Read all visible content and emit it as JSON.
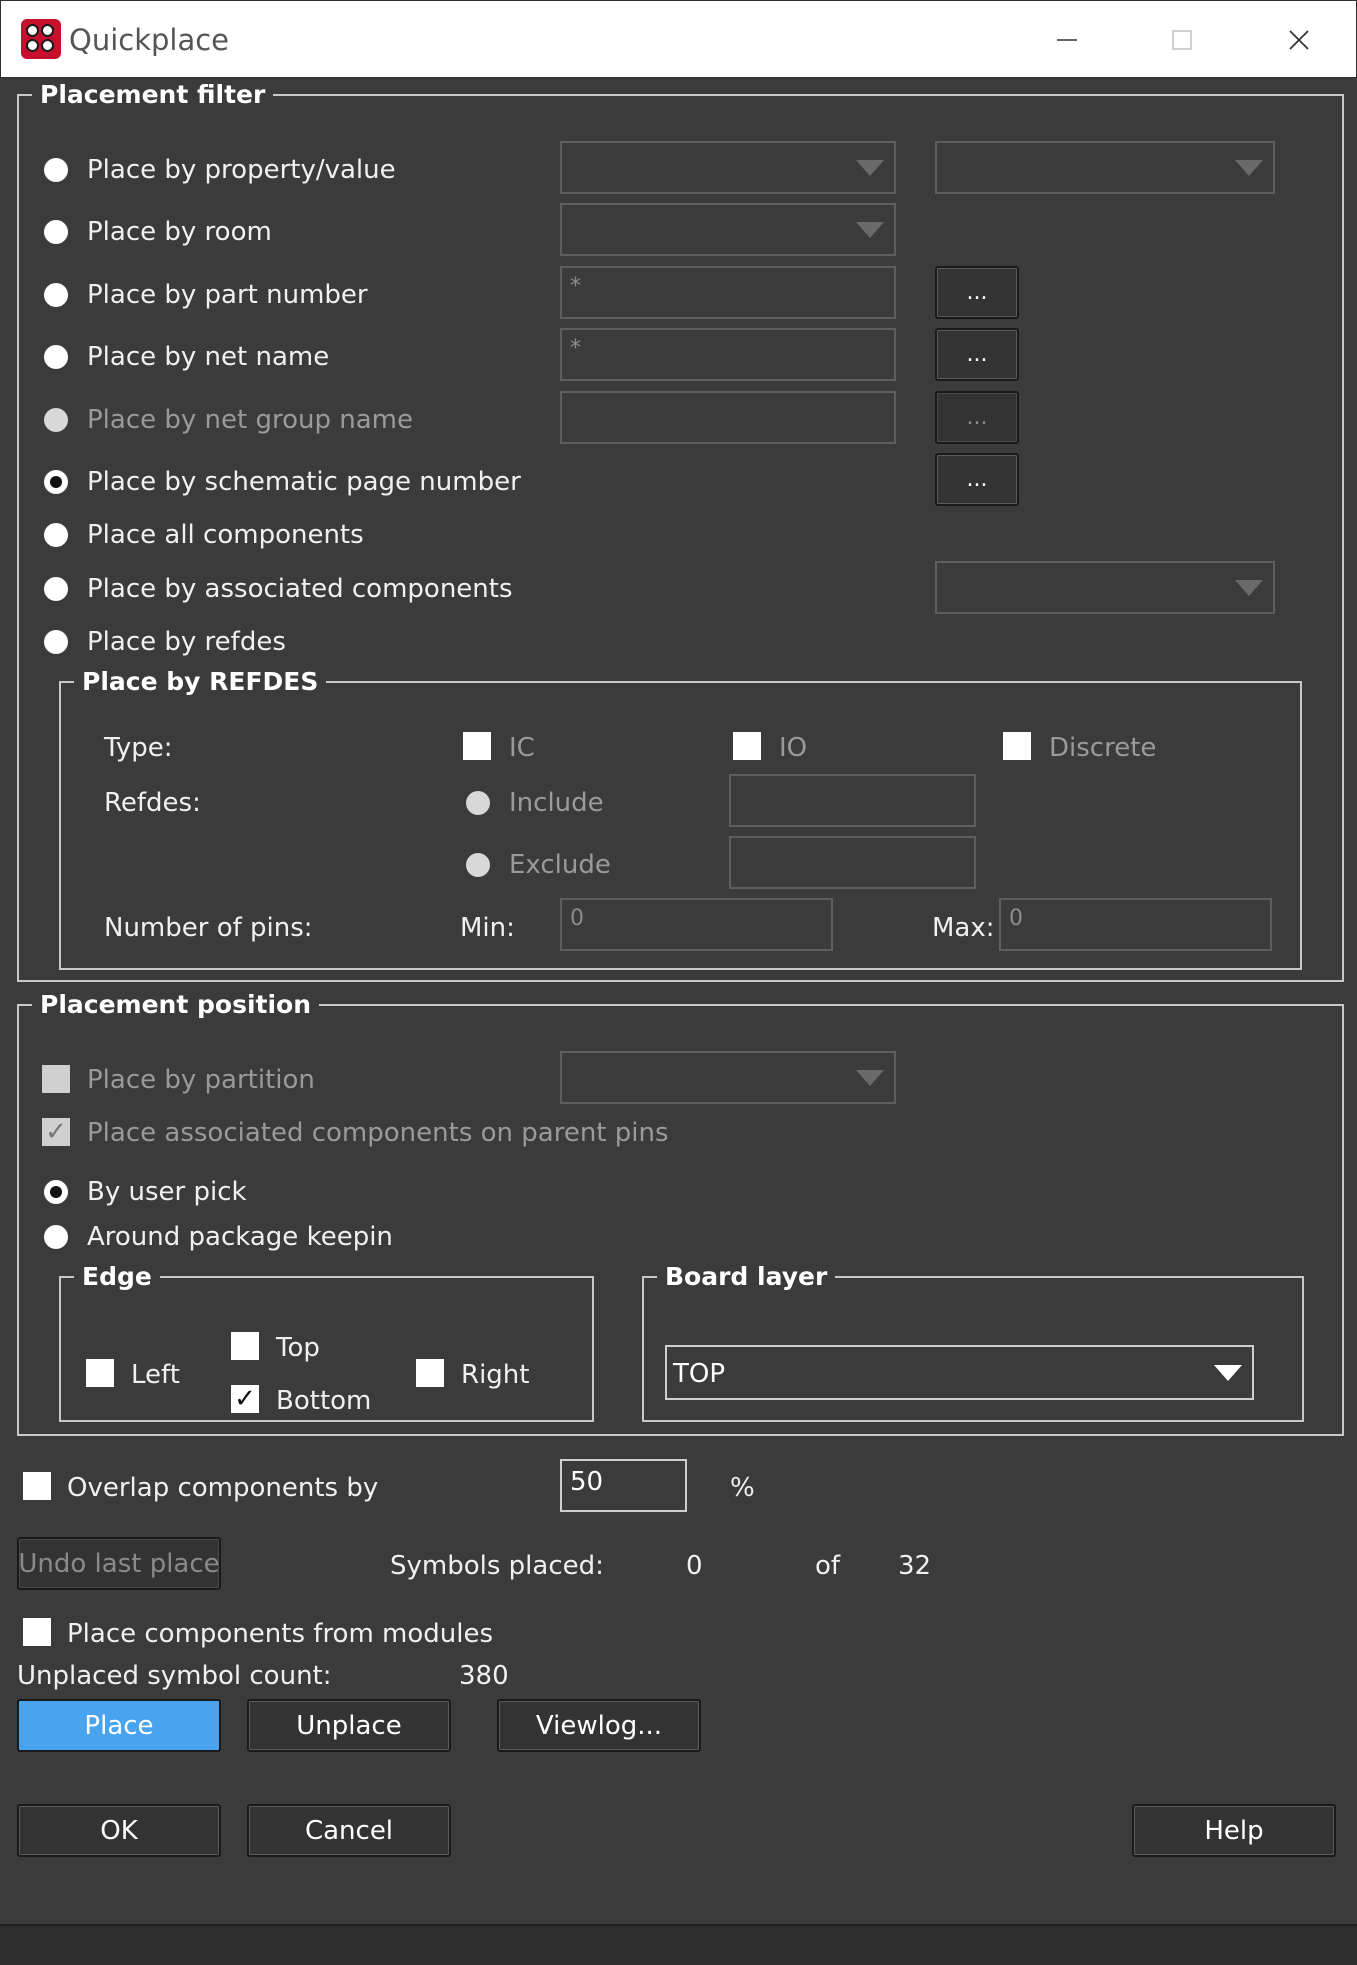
{
  "window": {
    "title": "Quickplace",
    "app_icon": "quickplace-app-icon",
    "controls": [
      "minimize-icon",
      "maximize-icon",
      "close-icon"
    ]
  },
  "placement_filter": {
    "legend": "Placement filter",
    "options": {
      "property_value": "Place by property/value",
      "room": "Place by room",
      "part_number": "Place by part number",
      "net_name": "Place by net name",
      "net_group_name": "Place by net group name",
      "schematic_page_number": "Place by schematic page number",
      "all_components": "Place all components",
      "associated_components": "Place by associated components",
      "refdes": "Place by refdes"
    },
    "selected": "schematic_page_number",
    "part_number_value": "*",
    "net_name_value": "*",
    "browse_label": "...",
    "refdes_group": {
      "legend": "Place by REFDES",
      "type_label": "Type:",
      "ic_label": "IC",
      "io_label": "IO",
      "discrete_label": "Discrete",
      "refdes_label": "Refdes:",
      "include_label": "Include",
      "exclude_label": "Exclude",
      "pins_label": "Number of pins:",
      "min_label": "Min:",
      "min_value": "0",
      "max_label": "Max:",
      "max_value": "0"
    }
  },
  "placement_position": {
    "legend": "Placement position",
    "partition_label": "Place by partition",
    "assoc_parent_label": "Place associated components on parent pins",
    "by_user_pick_label": "By user pick",
    "around_keepin_label": "Around package keepin",
    "selected": "by_user_pick",
    "edge": {
      "legend": "Edge",
      "left_label": "Left",
      "top_label": "Top",
      "bottom_label": "Bottom",
      "right_label": "Right",
      "bottom_checked": true
    },
    "board_layer": {
      "legend": "Board layer",
      "value": "TOP"
    }
  },
  "overlap": {
    "label": "Overlap components by",
    "value": "50",
    "unit": "%"
  },
  "undo_label": "Undo last place",
  "symbols_placed": {
    "label": "Symbols placed:",
    "count": "0",
    "of_label": "of",
    "total": "32"
  },
  "modules_label": "Place components from modules",
  "unplaced": {
    "label": "Unplaced symbol count:",
    "count": "380"
  },
  "buttons": {
    "place": "Place",
    "unplace": "Unplace",
    "viewlog": "Viewlog...",
    "ok": "OK",
    "cancel": "Cancel",
    "help": "Help"
  },
  "colors": {
    "background": "#3b3b3b",
    "primary_button": "#4aa3ee",
    "app_icon": "#c8102e"
  }
}
